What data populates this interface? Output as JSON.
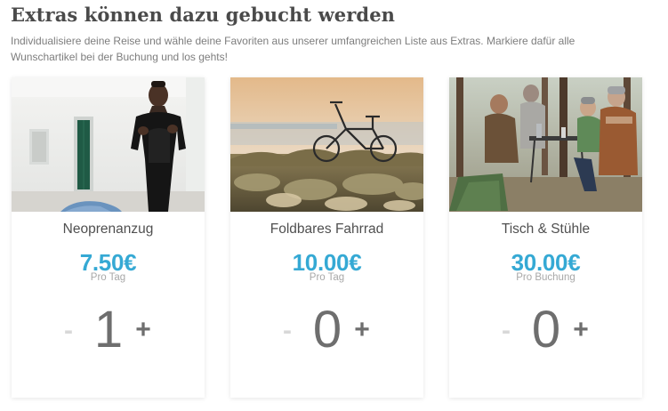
{
  "header": {
    "title": "Extras können dazu gebucht werden",
    "intro": "Individualisiere deine Reise und wähle deine Favoriten aus unserer umfangreichen Liste aus Extras. Markiere dafür alle Wunschartikel bei der Buchung und los gehts!"
  },
  "extras": [
    {
      "name": "Neoprenanzug",
      "price": "7.50€",
      "unit": "Pro Tag",
      "quantity": "1",
      "minus": "-",
      "plus": "+",
      "image": "person-in-wetsuit-photo"
    },
    {
      "name": "Foldbares Fahrrad",
      "price": "10.00€",
      "unit": "Pro Tag",
      "quantity": "0",
      "minus": "-",
      "plus": "+",
      "image": "folding-bike-at-sunset-photo"
    },
    {
      "name": "Tisch & Stühle",
      "price": "30.00€",
      "unit": "Pro Buchung",
      "quantity": "0",
      "minus": "-",
      "plus": "+",
      "image": "camping-table-and-chairs-photo"
    }
  ],
  "colors": {
    "title": "#4a4a4a",
    "intro": "#7d7d7d",
    "price": "#35a9d4",
    "unit": "#a8a8a8",
    "quantity": "#6e6e6e",
    "minus_disabled": "#d8d8d8"
  }
}
